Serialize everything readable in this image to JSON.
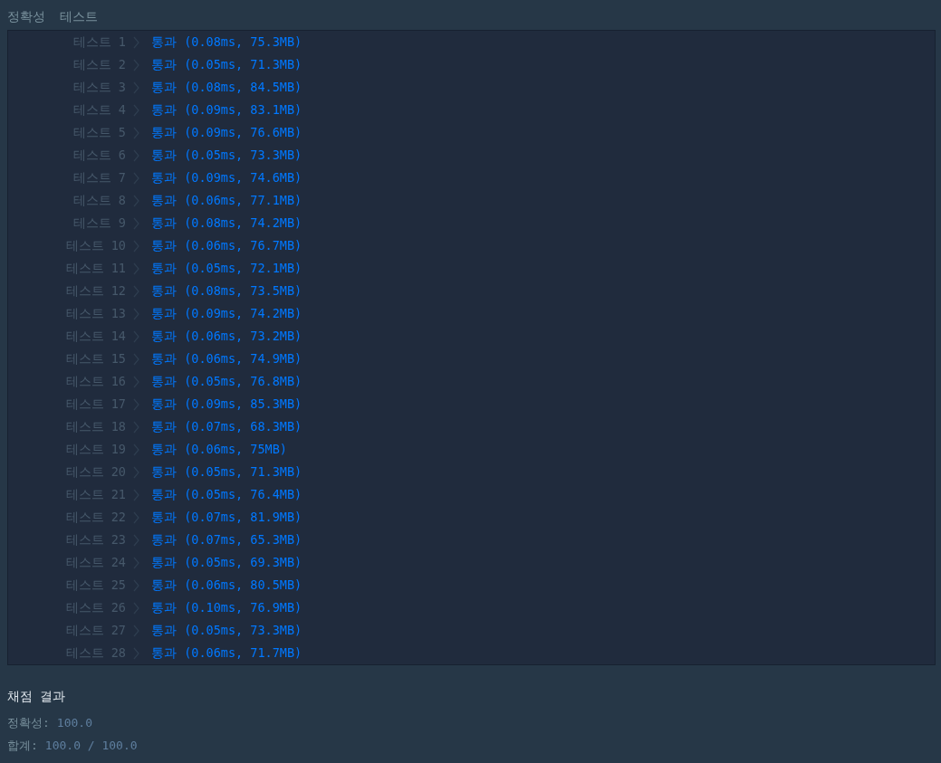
{
  "header": {
    "tabs": [
      "정확성",
      "테스트"
    ]
  },
  "tests": [
    {
      "label": "테스트 1",
      "result": "통과 (0.08ms, 75.3MB)"
    },
    {
      "label": "테스트 2",
      "result": "통과 (0.05ms, 71.3MB)"
    },
    {
      "label": "테스트 3",
      "result": "통과 (0.08ms, 84.5MB)"
    },
    {
      "label": "테스트 4",
      "result": "통과 (0.09ms, 83.1MB)"
    },
    {
      "label": "테스트 5",
      "result": "통과 (0.09ms, 76.6MB)"
    },
    {
      "label": "테스트 6",
      "result": "통과 (0.05ms, 73.3MB)"
    },
    {
      "label": "테스트 7",
      "result": "통과 (0.09ms, 74.6MB)"
    },
    {
      "label": "테스트 8",
      "result": "통과 (0.06ms, 77.1MB)"
    },
    {
      "label": "테스트 9",
      "result": "통과 (0.08ms, 74.2MB)"
    },
    {
      "label": "테스트 10",
      "result": "통과 (0.06ms, 76.7MB)"
    },
    {
      "label": "테스트 11",
      "result": "통과 (0.05ms, 72.1MB)"
    },
    {
      "label": "테스트 12",
      "result": "통과 (0.08ms, 73.5MB)"
    },
    {
      "label": "테스트 13",
      "result": "통과 (0.09ms, 74.2MB)"
    },
    {
      "label": "테스트 14",
      "result": "통과 (0.06ms, 73.2MB)"
    },
    {
      "label": "테스트 15",
      "result": "통과 (0.06ms, 74.9MB)"
    },
    {
      "label": "테스트 16",
      "result": "통과 (0.05ms, 76.8MB)"
    },
    {
      "label": "테스트 17",
      "result": "통과 (0.09ms, 85.3MB)"
    },
    {
      "label": "테스트 18",
      "result": "통과 (0.07ms, 68.3MB)"
    },
    {
      "label": "테스트 19",
      "result": "통과 (0.06ms, 75MB)"
    },
    {
      "label": "테스트 20",
      "result": "통과 (0.05ms, 71.3MB)"
    },
    {
      "label": "테스트 21",
      "result": "통과 (0.05ms, 76.4MB)"
    },
    {
      "label": "테스트 22",
      "result": "통과 (0.07ms, 81.9MB)"
    },
    {
      "label": "테스트 23",
      "result": "통과 (0.07ms, 65.3MB)"
    },
    {
      "label": "테스트 24",
      "result": "통과 (0.05ms, 69.3MB)"
    },
    {
      "label": "테스트 25",
      "result": "통과 (0.06ms, 80.5MB)"
    },
    {
      "label": "테스트 26",
      "result": "통과 (0.10ms, 76.9MB)"
    },
    {
      "label": "테스트 27",
      "result": "통과 (0.05ms, 73.3MB)"
    },
    {
      "label": "테스트 28",
      "result": "통과 (0.06ms, 71.7MB)"
    }
  ],
  "summary": {
    "title": "채점 결과",
    "lines": [
      {
        "label": "정확성:",
        "value": "100.0"
      },
      {
        "label": "합계:",
        "value": "100.0 / 100.0"
      }
    ]
  }
}
